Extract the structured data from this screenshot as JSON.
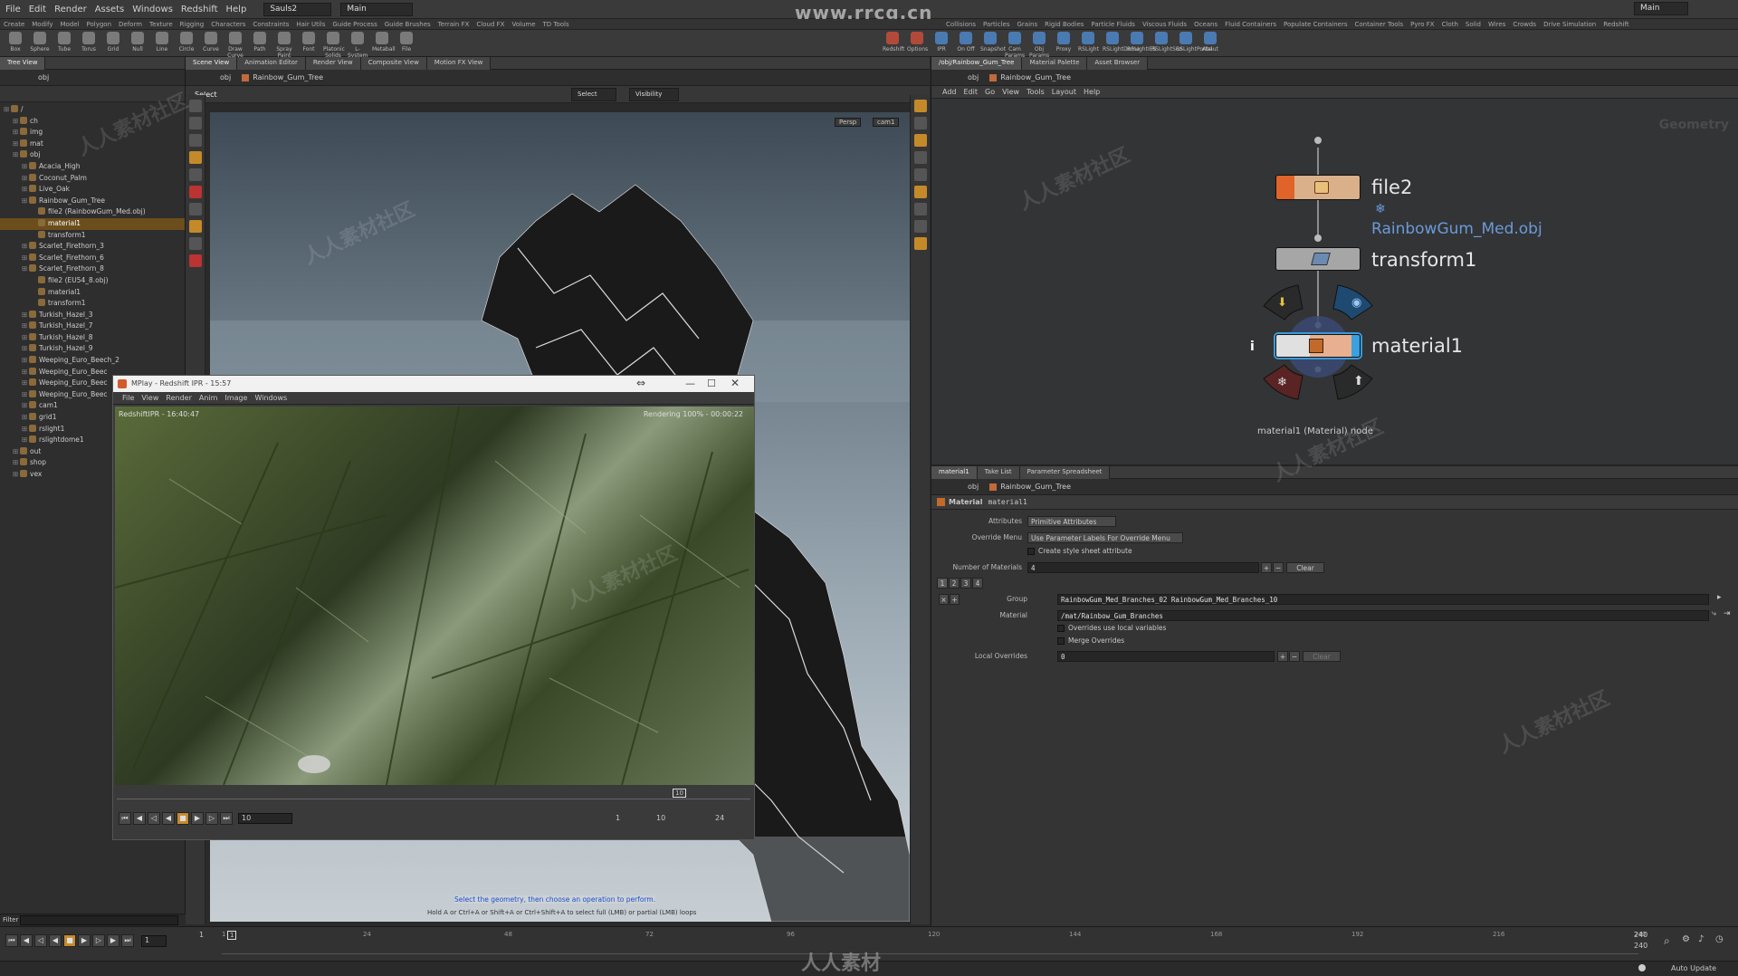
{
  "watermark": {
    "site": "www.rrcg.cn",
    "logo_text": "人人素材",
    "tile_text": "人人素材社区"
  },
  "menubar": {
    "items": [
      "File",
      "Edit",
      "Render",
      "Assets",
      "Windows",
      "Redshift",
      "Help"
    ],
    "desktop": "Sauls2",
    "context": "Main",
    "right_context": "Main"
  },
  "shelf_tabs_left": [
    "Create",
    "Modify",
    "Model",
    "Polygon",
    "Deform",
    "Texture",
    "Rigging",
    "Characters",
    "Constraints",
    "Hair Utils",
    "Guide Process",
    "Guide Brushes",
    "Terrain FX",
    "Cloud FX",
    "Volume",
    "TD Tools"
  ],
  "shelf_tabs_right": [
    "Collisions",
    "Particles",
    "Grains",
    "Rigid Bodies",
    "Particle Fluids",
    "Viscous Fluids",
    "Oceans",
    "Fluid Containers",
    "Populate Containers",
    "Container Tools",
    "Pyro FX",
    "Cloth",
    "Solid",
    "Wires",
    "Crowds",
    "Drive Simulation",
    "Redshift"
  ],
  "shelf_tools_left": [
    "Box",
    "Sphere",
    "Tube",
    "Torus",
    "Grid",
    "Null",
    "Line",
    "Circle",
    "Curve",
    "Draw Curve",
    "Path",
    "Spray Paint",
    "Font",
    "Platonic Solids",
    "L-System",
    "Metaball",
    "File"
  ],
  "shelf_tools_right": [
    "Redshift",
    "Options",
    "IPR",
    "On Off",
    "Snapshot",
    "Cam Params",
    "Obj Params",
    "Proxy",
    "RSLight",
    "RSLightDome",
    "RSLightIES",
    "RSLightSun",
    "RSLightPortal",
    "Abaut"
  ],
  "tree": {
    "tab": "Tree View",
    "path": "obj",
    "filter_label": "Filter",
    "items": [
      {
        "label": "/",
        "depth": 0,
        "selected": false
      },
      {
        "label": "ch",
        "depth": 1,
        "selected": false
      },
      {
        "label": "img",
        "depth": 1,
        "selected": false
      },
      {
        "label": "mat",
        "depth": 1,
        "selected": false
      },
      {
        "label": "obj",
        "depth": 1,
        "selected": false
      },
      {
        "label": "Acacia_High",
        "depth": 2,
        "selected": false
      },
      {
        "label": "Coconut_Palm",
        "depth": 2,
        "selected": false
      },
      {
        "label": "Live_Oak",
        "depth": 2,
        "selected": false
      },
      {
        "label": "Rainbow_Gum_Tree",
        "depth": 2,
        "selected": false
      },
      {
        "label": "file2 (RainbowGum_Med.obj)",
        "depth": 3,
        "selected": false
      },
      {
        "label": "material1",
        "depth": 3,
        "selected": true
      },
      {
        "label": "transform1",
        "depth": 3,
        "selected": false
      },
      {
        "label": "Scarlet_Firethorn_3",
        "depth": 2,
        "selected": false
      },
      {
        "label": "Scarlet_Firethorn_6",
        "depth": 2,
        "selected": false
      },
      {
        "label": "Scarlet_Firethorn_8",
        "depth": 2,
        "selected": false
      },
      {
        "label": "file2 (EU54_8.obj)",
        "depth": 3,
        "selected": false
      },
      {
        "label": "material1",
        "depth": 3,
        "selected": false
      },
      {
        "label": "transform1",
        "depth": 3,
        "selected": false
      },
      {
        "label": "Turkish_Hazel_3",
        "depth": 2,
        "selected": false
      },
      {
        "label": "Turkish_Hazel_7",
        "depth": 2,
        "selected": false
      },
      {
        "label": "Turkish_Hazel_8",
        "depth": 2,
        "selected": false
      },
      {
        "label": "Turkish_Hazel_9",
        "depth": 2,
        "selected": false
      },
      {
        "label": "Weeping_Euro_Beech_2",
        "depth": 2,
        "selected": false
      },
      {
        "label": "Weeping_Euro_Beec",
        "depth": 2,
        "selected": false
      },
      {
        "label": "Weeping_Euro_Beec",
        "depth": 2,
        "selected": false
      },
      {
        "label": "Weeping_Euro_Beec",
        "depth": 2,
        "selected": false
      },
      {
        "label": "cam1",
        "depth": 2,
        "selected": false
      },
      {
        "label": "grid1",
        "depth": 2,
        "selected": false
      },
      {
        "label": "rslight1",
        "depth": 2,
        "selected": false
      },
      {
        "label": "rslightdome1",
        "depth": 2,
        "selected": false
      },
      {
        "label": "out",
        "depth": 1,
        "selected": false
      },
      {
        "label": "shop",
        "depth": 1,
        "selected": false
      },
      {
        "label": "vex",
        "depth": 1,
        "selected": false
      }
    ]
  },
  "scene": {
    "tabs": [
      "Scene View",
      "Animation Editor",
      "Render View",
      "Composite View",
      "Motion FX View"
    ],
    "path_root": "obj",
    "path_node": "Rainbow_Gum_Tree",
    "tool_label": "Select",
    "select_combo": "Select",
    "visibility_combo": "Visibility",
    "persp": "Persp",
    "cam": "cam1",
    "prompt": "Select the geometry, then choose an operation to perform.",
    "hint": "Hold A or Ctrl+A or Shift+A or Ctrl+Shift+A to select full (LMB) or partial (LMB) loops"
  },
  "mplay": {
    "title": "MPlay - Redshift IPR - 15:57",
    "menu": [
      "File",
      "View",
      "Render",
      "Anim",
      "Image",
      "Windows"
    ],
    "overlay_left": "RedshiftIPR - 16:40:47",
    "overlay_right": "Rendering 100% - 00:00:22",
    "frame": "10",
    "range_start": "1",
    "range_end": "10",
    "fps": "24"
  },
  "network": {
    "tabs": [
      "/obj/Rainbow_Gum_Tree",
      "Material Palette",
      "Asset Browser"
    ],
    "path_root": "obj",
    "path_node": "Rainbow_Gum_Tree",
    "menu": [
      "Add",
      "Edit",
      "Go",
      "View",
      "Tools",
      "Layout",
      "Help"
    ],
    "context_label": "Geometry",
    "nodes": [
      {
        "name": "file2",
        "sub": "RainbowGum_Med.obj"
      },
      {
        "name": "transform1",
        "sub": ""
      },
      {
        "name": "material1",
        "sub": ""
      }
    ],
    "info": "material1 (Material) node"
  },
  "params": {
    "tabs": [
      "material1",
      "Take List",
      "Parameter Spreadsheet"
    ],
    "path_root": "obj",
    "path_node": "Rainbow_Gum_Tree",
    "op_type": "Material",
    "op_name": "material1",
    "attributes_label": "Attributes",
    "attributes_value": "Primitive Attributes",
    "override_label": "Override Menu",
    "override_value": "Use Parameter Labels For Override Menu",
    "style_sheet_label": "Create style sheet attribute",
    "num_materials_label": "Number of Materials",
    "num_materials_value": "4",
    "clear_label": "Clear",
    "multi_tabs": [
      "1",
      "2",
      "3",
      "4"
    ],
    "group_label": "Group",
    "group_value": "RainbowGum_Med_Branches_02 RainbowGum_Med_Branches_10",
    "material_label": "Material",
    "material_value": "/mat/Rainbow_Gum_Branches",
    "overrides_local": "Overrides use local variables",
    "merge_overrides": "Merge Overrides",
    "local_overrides_label": "Local Overrides",
    "local_overrides_value": "0"
  },
  "timeline": {
    "frame": "1",
    "start": "1",
    "ticks": [
      "1",
      "24",
      "48",
      "72",
      "96",
      "120",
      "144",
      "168",
      "192",
      "216",
      "240"
    ],
    "end1": "240",
    "end2": "240"
  },
  "status": {
    "auto_update": "Auto Update"
  },
  "colors": {
    "accent": "#c48a2a",
    "selected_row": "#6b4e1c",
    "node_material": "#d9a08a"
  }
}
